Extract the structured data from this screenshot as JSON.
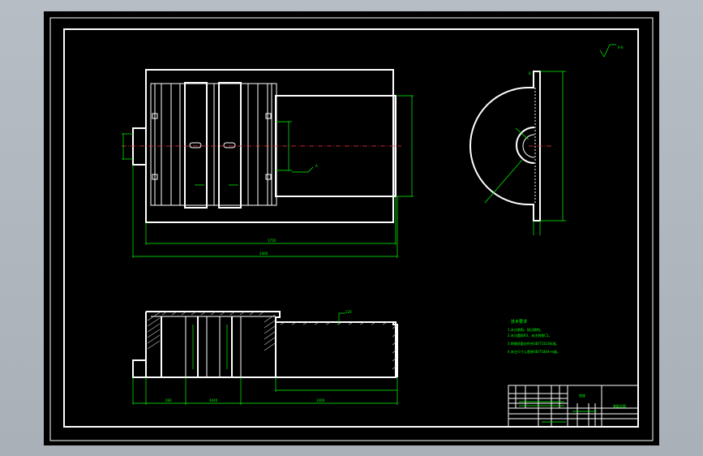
{
  "drawing": {
    "top_view_dims": [
      "1750",
      "2400"
    ],
    "top_view_note": "A",
    "side_view_section": "B",
    "section_mark": "6-6",
    "front_view_dims": [
      "260",
      "3040",
      "1400",
      "120"
    ],
    "notes_title": "技术要求",
    "notes": [
      "1.未注倒角，锐边倒钝。",
      "2.未注圆角R3，未注倒角C1。",
      "3.焊缝质量应符合GB/T3323标准。",
      "4.未注尺寸公差按GB/T1804-m级。"
    ],
    "title_block": {
      "part_name": "底座",
      "drawing_name": "装配总图"
    }
  },
  "colors": {
    "background": "#000000",
    "outline": "#ffffff",
    "dimension": "#00ff00",
    "centerline": "#ff3333"
  }
}
